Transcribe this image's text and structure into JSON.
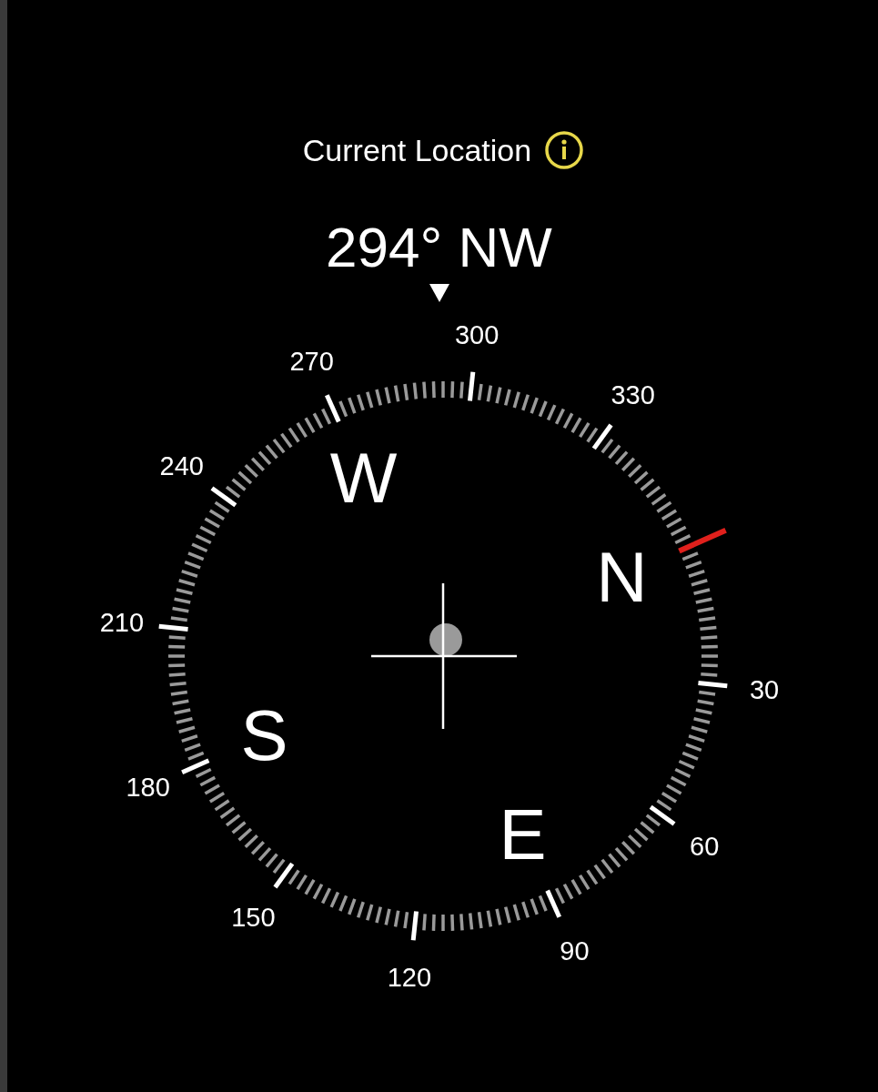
{
  "header": {
    "title": "Current Location",
    "heading": "294° NW"
  },
  "dial": {
    "degree_labels": [
      "30",
      "60",
      "90",
      "120",
      "150",
      "180",
      "210",
      "240",
      "270",
      "300",
      "330"
    ],
    "cardinals": [
      "N",
      "E",
      "S",
      "W"
    ]
  }
}
